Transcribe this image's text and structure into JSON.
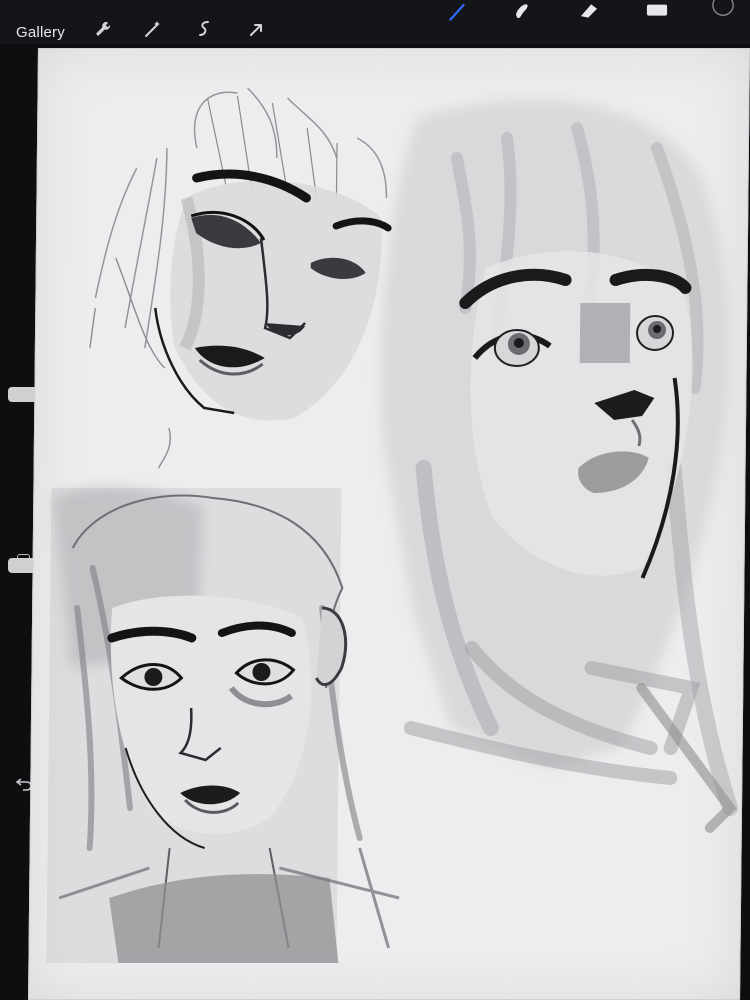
{
  "toolbar": {
    "gallery_label": "Gallery",
    "left_tools": [
      "wrench-icon",
      "magic-wand-icon",
      "selection-icon",
      "transform-arrow-icon"
    ],
    "right_tools": [
      "brush-icon",
      "smudge-icon",
      "eraser-icon",
      "layers-icon"
    ],
    "accent_color": "#2f6bff"
  },
  "sidebar": {
    "controls": [
      "brush-size-slider",
      "modify-button",
      "opacity-slider",
      "undo-icon"
    ]
  },
  "canvas": {
    "background": "#ecedee",
    "content": [
      "sketch-face-top-left",
      "sketch-face-right",
      "sketch-face-bottom-left"
    ]
  }
}
